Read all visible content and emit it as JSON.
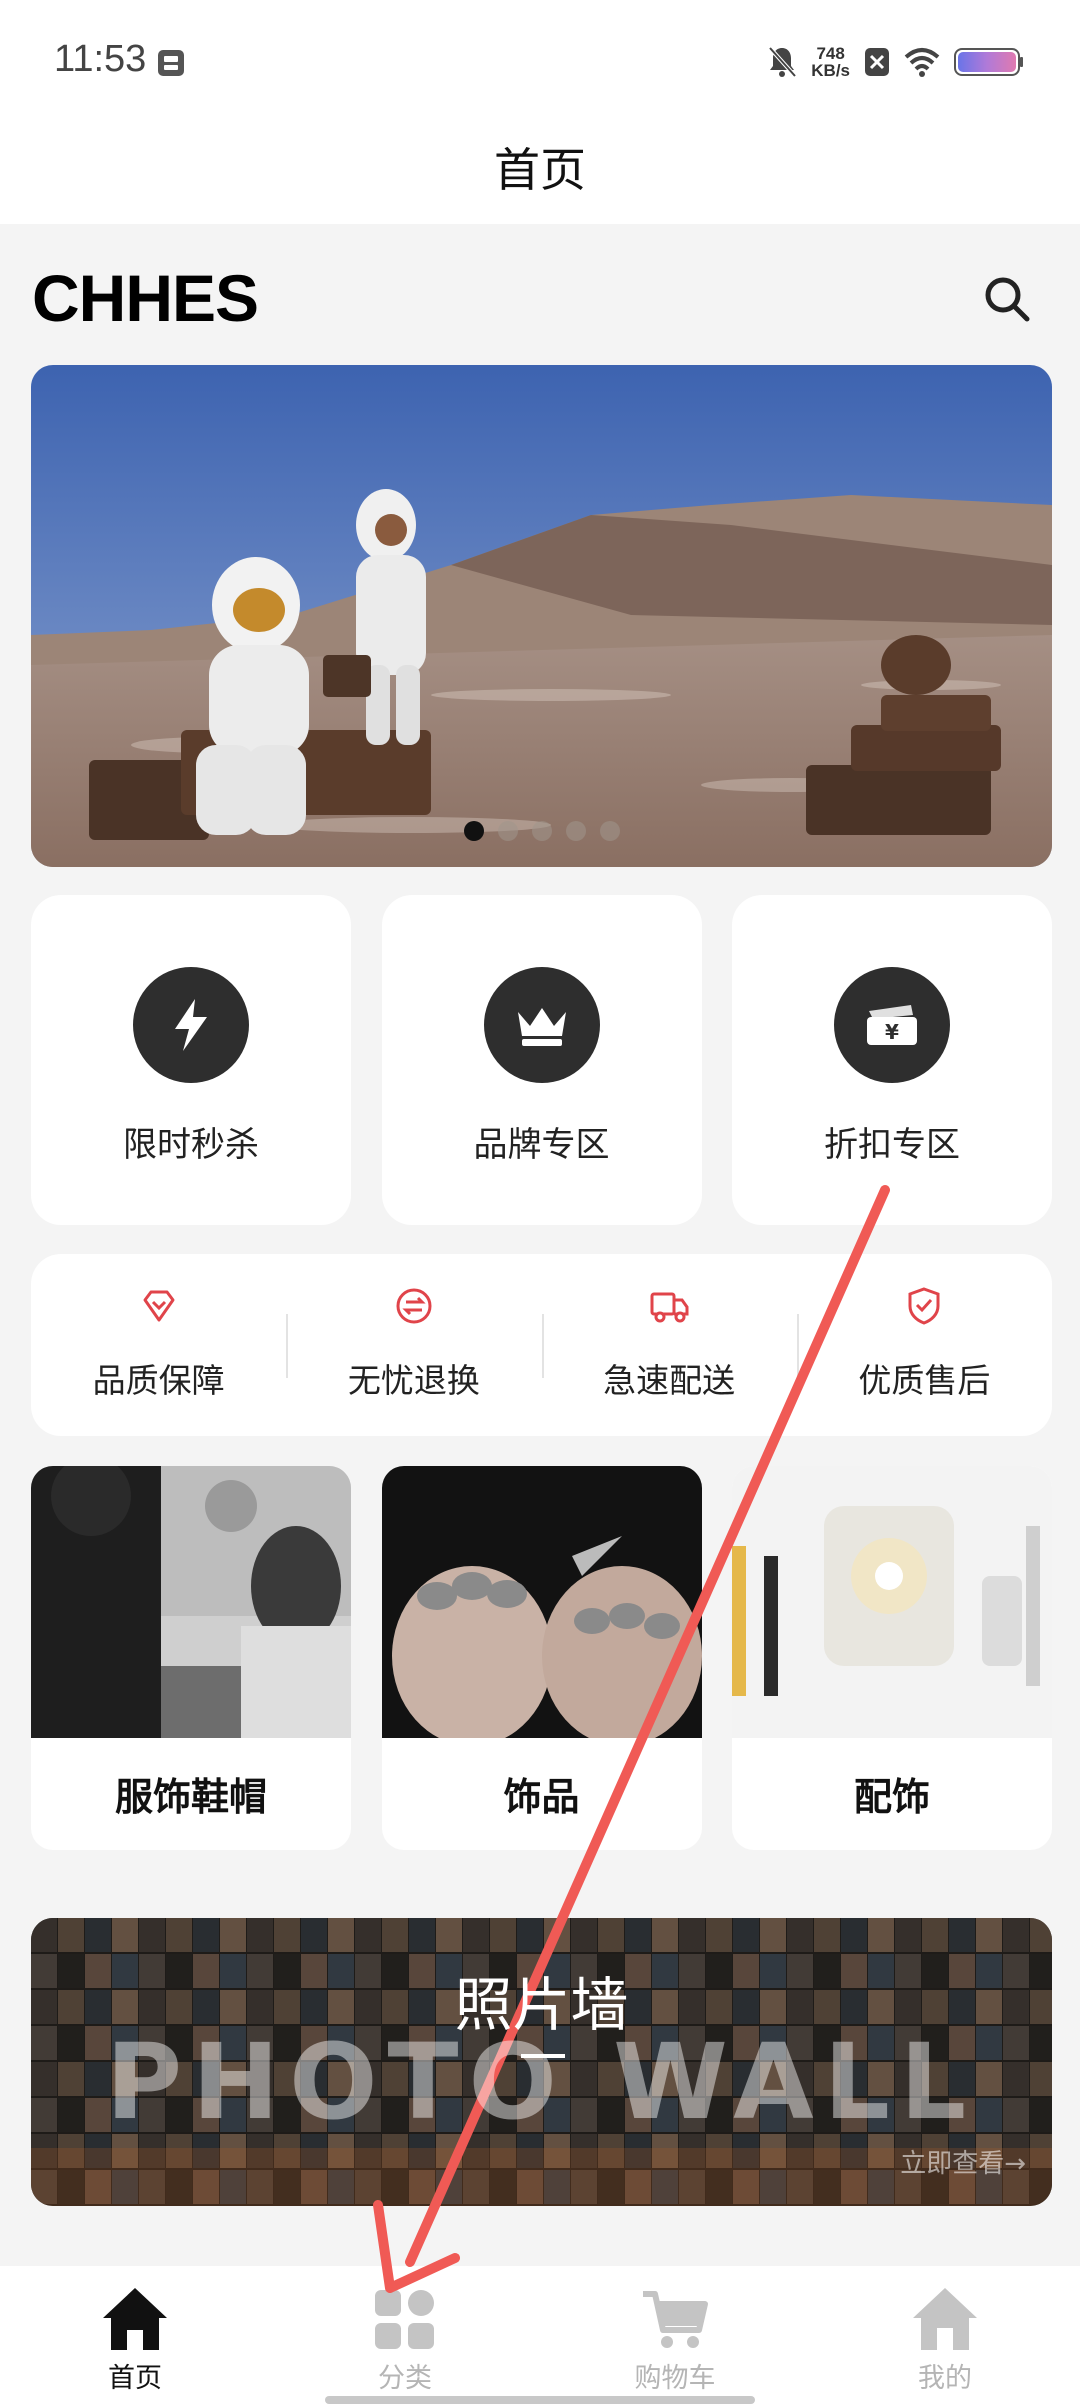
{
  "status_bar": {
    "time": "11:53",
    "net_speed_value": "748",
    "net_speed_unit": "KB/s",
    "icons": [
      "sim-card-icon",
      "bell-muted-icon",
      "no-sim-icon",
      "wifi-icon",
      "battery-icon"
    ]
  },
  "header": {
    "title": "首页"
  },
  "brand": {
    "logo": "CHHES",
    "search_icon": "search-icon"
  },
  "banner": {
    "slide_count": 5,
    "active_index": 0
  },
  "tiles": [
    {
      "label": "限时秒杀",
      "icon": "lightning-icon"
    },
    {
      "label": "品牌专区",
      "icon": "crown-icon"
    },
    {
      "label": "折扣专区",
      "icon": "yen-ticket-icon"
    }
  ],
  "guarantees": [
    {
      "label": "品质保障",
      "icon": "diamond-heart-icon"
    },
    {
      "label": "无忧退换",
      "icon": "exchange-icon"
    },
    {
      "label": "急速配送",
      "icon": "delivery-truck-icon"
    },
    {
      "label": "优质售后",
      "icon": "shield-check-icon"
    }
  ],
  "categories": [
    {
      "label": "服饰鞋帽"
    },
    {
      "label": "饰品"
    },
    {
      "label": "配饰"
    }
  ],
  "photo_wall": {
    "title": "照片墙",
    "watermark": "PHOTO WALL",
    "more": "立即查看→"
  },
  "tab_bar": {
    "active_index": 0,
    "items": [
      {
        "label": "首页",
        "icon": "home-icon"
      },
      {
        "label": "分类",
        "icon": "category-grid-icon"
      },
      {
        "label": "购物车",
        "icon": "cart-icon"
      },
      {
        "label": "我的",
        "icon": "profile-home-icon"
      }
    ]
  },
  "colors": {
    "accent_red": "#e0444a",
    "annotation_arrow": "#f05a55",
    "tile_circle": "#2e2e2e",
    "tab_inactive": "#b5b5b5",
    "page_bg": "#f4f4f4"
  }
}
